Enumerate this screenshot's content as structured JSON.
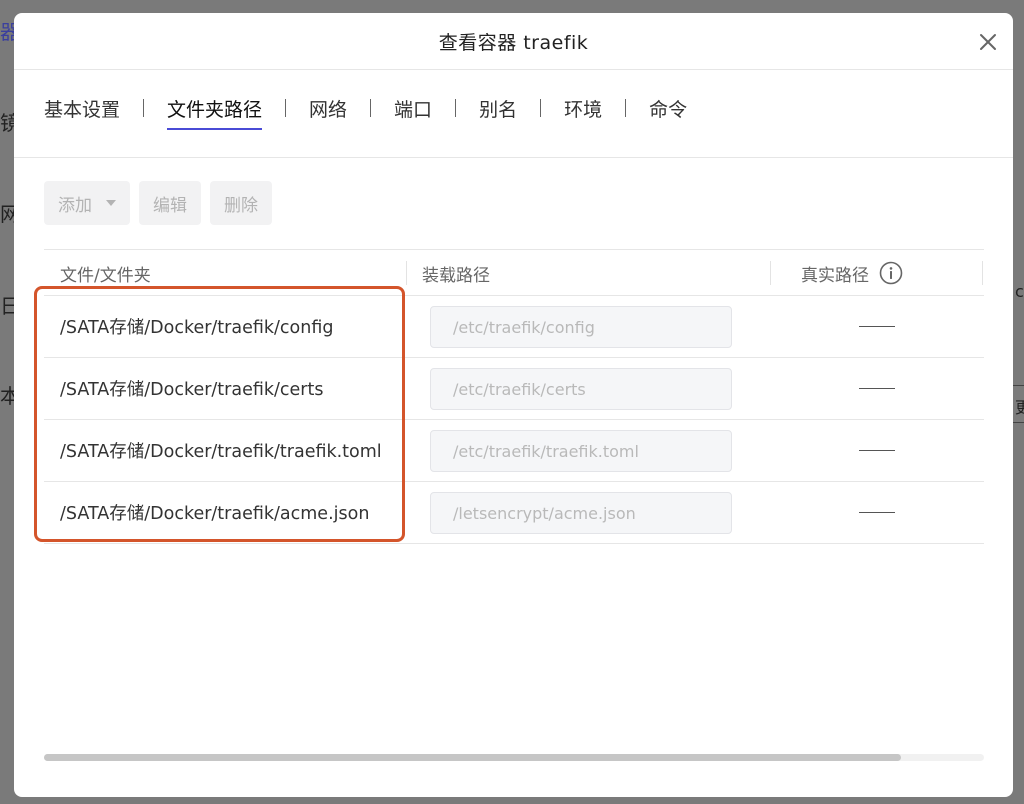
{
  "background": {
    "left_chars": [
      "器",
      "镜",
      "网",
      "日",
      "本"
    ],
    "right_fragments": [
      "cl",
      "更"
    ]
  },
  "dialog": {
    "title": "查看容器 traefik",
    "close_icon": "close-icon"
  },
  "tabs": [
    {
      "label": "基本设置",
      "active": false
    },
    {
      "label": "文件夹路径",
      "active": true
    },
    {
      "label": "网络",
      "active": false
    },
    {
      "label": "端口",
      "active": false
    },
    {
      "label": "别名",
      "active": false
    },
    {
      "label": "环境",
      "active": false
    },
    {
      "label": "命令",
      "active": false
    }
  ],
  "toolbar": {
    "add_label": "添加",
    "edit_label": "编辑",
    "delete_label": "删除"
  },
  "table": {
    "columns": {
      "file": "文件/文件夹",
      "mount": "装载路径",
      "real": "真实路径"
    },
    "rows": [
      {
        "file": "/SATA存储/Docker/traefik/config",
        "mount": "/etc/traefik/config",
        "real": "——"
      },
      {
        "file": "/SATA存储/Docker/traefik/certs",
        "mount": "/etc/traefik/certs",
        "real": "——"
      },
      {
        "file": "/SATA存储/Docker/traefik/traefik.toml",
        "mount": "/etc/traefik/traefik.toml",
        "real": "——"
      },
      {
        "file": "/SATA存储/Docker/traefik/acme.json",
        "mount": "/letsencrypt/acme.json",
        "real": "——"
      }
    ]
  },
  "colors": {
    "tab_active_underline": "#4a4bd6",
    "highlight_border": "#d4552b",
    "overlay": "#7a7a7a"
  }
}
